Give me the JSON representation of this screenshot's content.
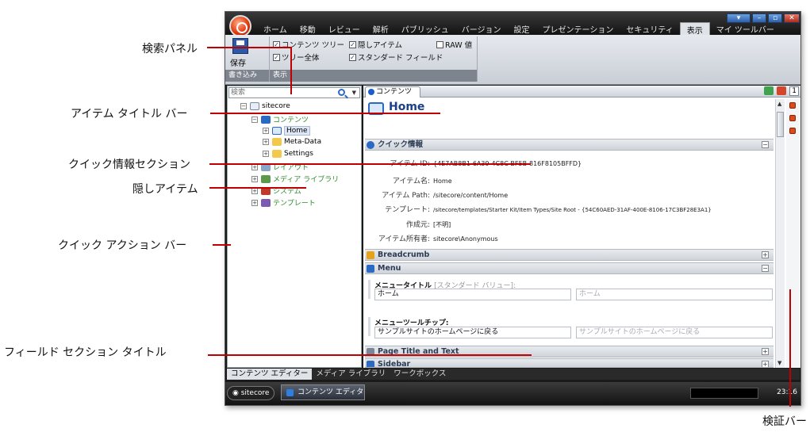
{
  "annotations": {
    "search_panel": "検索パネル",
    "item_title_bar": "アイテム タイトル バー",
    "quick_info_section": "クイック情報セクション",
    "hidden_item": "隠しアイテム",
    "quick_action_bar": "クイック アクション バー",
    "field_section_title": "フィールド セクション タイトル",
    "validation_bar": "検証バー"
  },
  "menu": {
    "tabs": [
      "ホーム",
      "移動",
      "レビュー",
      "解析",
      "パブリッシュ",
      "バージョン",
      "設定",
      "プレゼンテーション",
      "セキュリティ",
      "表示",
      "マイ ツールバー"
    ],
    "active_index": 9
  },
  "ribbon": {
    "save_label": "保存",
    "write_group_label": "書き込み",
    "view_group_label": "表示",
    "checkboxes": [
      {
        "label": "コンテンツ ツリー",
        "checked": true
      },
      {
        "label": "ツリー全体",
        "checked": true
      },
      {
        "label": "隠しアイテム",
        "checked": true
      },
      {
        "label": "スタンダード フィールド",
        "checked": true
      },
      {
        "label": "RAW 値",
        "checked": false
      }
    ]
  },
  "search": {
    "placeholder": "検索"
  },
  "tree": {
    "root": "sitecore",
    "items": [
      {
        "label": "コンテンツ",
        "hidden": true
      },
      {
        "label": "Home",
        "hidden": false
      },
      {
        "label": "Meta-Data",
        "hidden": false
      },
      {
        "label": "Settings",
        "hidden": false
      },
      {
        "label": "レイアウト",
        "hidden": true
      },
      {
        "label": "メディア ライブラリ",
        "hidden": true
      },
      {
        "label": "システム",
        "hidden": true
      },
      {
        "label": "テンプレート",
        "hidden": true
      }
    ]
  },
  "content_tab": {
    "label": "コンテンツ"
  },
  "item": {
    "title": "Home"
  },
  "quick_info": {
    "title": "クイック情報",
    "rows": [
      {
        "label": "アイテム ID:",
        "value": "{4E7AB8B1-6A39-4C8C-BF5B-816F8105BFFD}"
      },
      {
        "label": "アイテム名:",
        "value": "Home"
      },
      {
        "label": "アイテム Path:",
        "value": "/sitecore/content/Home"
      },
      {
        "label": "テンプレート:",
        "value": "/sitecore/templates/Starter Kit/Item Types/Site Root - {54C60AED-31AF-400E-8106-17C3BF28E3A1}"
      },
      {
        "label": "作成元:",
        "value": "[不明]"
      },
      {
        "label": "アイテム所有者:",
        "value": "sitecore\\Anonymous"
      }
    ]
  },
  "sections": {
    "breadcrumb": "Breadcrumb",
    "menu": "Menu",
    "page_title": "Page Title and Text",
    "sidebar": "Sidebar"
  },
  "fields": {
    "menu_title_label": "メニュータイトル",
    "standard_value_note": "[スタンダード バリュー]:",
    "menu_title_value": "ホーム",
    "menu_title_std": "ホーム",
    "tooltip_label": "メニューツールチップ:",
    "tooltip_value": "サンプルサイトのホームページに戻る",
    "tooltip_std": "サンプルサイトのホームページに戻る"
  },
  "bottom_tabs": [
    "コンテンツ エディター",
    "メディア ライブラリ",
    "ワークボックス"
  ],
  "taskbar": {
    "start": "sitecore",
    "task": "コンテンツ エディター",
    "clock": "23:16"
  },
  "zoom_badge": "1"
}
